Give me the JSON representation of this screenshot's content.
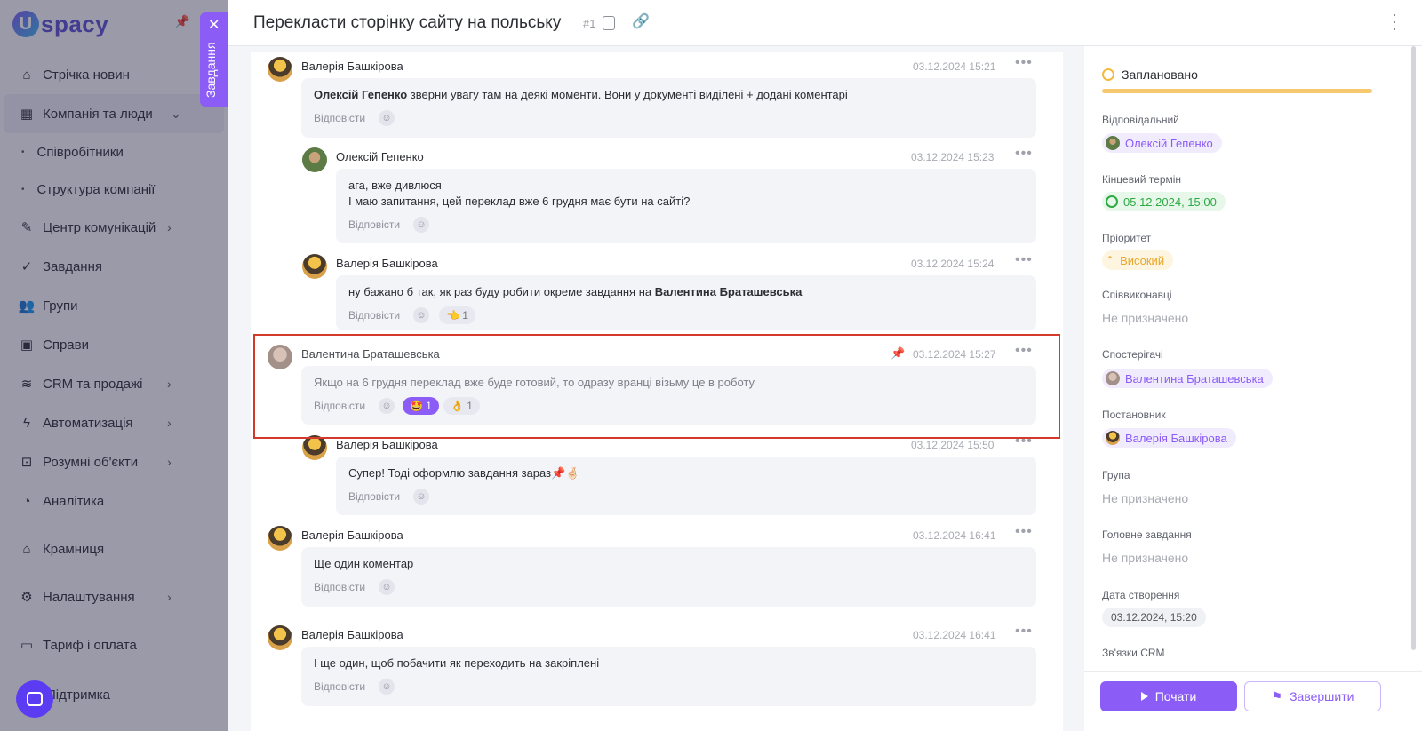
{
  "app": {
    "logo_text": "spacy",
    "tab_tag": "Завдання"
  },
  "sidebar": {
    "items": [
      {
        "label": "Стрічка новин"
      },
      {
        "label": "Компанія та люди"
      },
      {
        "label": "Співробітники"
      },
      {
        "label": "Структура компанії"
      },
      {
        "label": "Центр комунікацій"
      },
      {
        "label": "Завдання"
      },
      {
        "label": "Групи"
      },
      {
        "label": "Справи"
      },
      {
        "label": "CRM та продажі"
      },
      {
        "label": "Автоматизація"
      },
      {
        "label": "Розумні об'єкти"
      },
      {
        "label": "Аналітика"
      },
      {
        "label": "Крамниця"
      },
      {
        "label": "Налаштування"
      },
      {
        "label": "Тариф і оплата"
      },
      {
        "label": "Підтримка"
      }
    ]
  },
  "header": {
    "title": "Перекласти сторінку сайту на польську",
    "task_number": "#1"
  },
  "comments": [
    {
      "author": "Валерія Башкірова",
      "time": "03.12.2024 15:21",
      "mention": "Олексій Гепенко",
      "text": " зверни увагу там на деякі моменти. Вони у документі виділені + додані коментарі",
      "reply": "Відповісти"
    },
    {
      "author": "Олексій Гепенко",
      "time": "03.12.2024 15:23",
      "line1": " ага, вже дивлюся",
      "line2": "І маю запитання, цей переклад вже 6 грудня має бути на сайті?",
      "reply": "Відповісти"
    },
    {
      "author": "Валерія Башкірова",
      "time": "03.12.2024 15:24",
      "text": "ну бажано б так, як раз буду робити окреме завдання на ",
      "mention": "Валентина Браташевська",
      "reply": "Відповісти",
      "reaction": "👈 1"
    },
    {
      "author": "Валентина Браташевська",
      "time": "03.12.2024 15:27",
      "text": "Якщо на 6 грудня переклад вже буде готовий, то одразу вранці візьму це в роботу",
      "reply": "Відповісти",
      "reaction1": "🤩 1",
      "reaction2": "👌 1"
    },
    {
      "author": "Валерія Башкірова",
      "time": "03.12.2024 15:50",
      "text": "Супер! Тоді оформлю завдання зараз📌🤞🏻",
      "reply": "Відповісти"
    },
    {
      "author": "Валерія Башкірова",
      "time": "03.12.2024 16:41",
      "text": "Ще один коментар",
      "reply": "Відповісти"
    },
    {
      "author": "Валерія Башкірова",
      "time": "03.12.2024 16:41",
      "text": "І ще один, щоб побачити як переходить на закріплені",
      "reply": "Відповісти"
    }
  ],
  "details": {
    "status": "Заплановано",
    "responsible_label": "Відповідальний",
    "responsible": "Олексій Гепенко",
    "deadline_label": "Кінцевий термін",
    "deadline": "05.12.2024, 15:00",
    "priority_label": "Пріоритет",
    "priority": "Високий",
    "coexec_label": "Співвиконавці",
    "coexec": "Не призначено",
    "observers_label": "Спостерігачі",
    "observer": "Валентина Браташевська",
    "creator_label": "Постановник",
    "creator": "Валерія Башкірова",
    "group_label": "Група",
    "group": "Не призначено",
    "parent_label": "Головне завдання",
    "parent": "Не призначено",
    "created_label": "Дата створення",
    "created": "03.12.2024, 15:20",
    "crm_label": "Зв'язки CRM"
  },
  "actions": {
    "start": "Почати",
    "finish": "Завершити"
  },
  "colors": {
    "accent": "#8b5cf6",
    "highlight": "#d33a2c",
    "status": "#f7c96e"
  }
}
